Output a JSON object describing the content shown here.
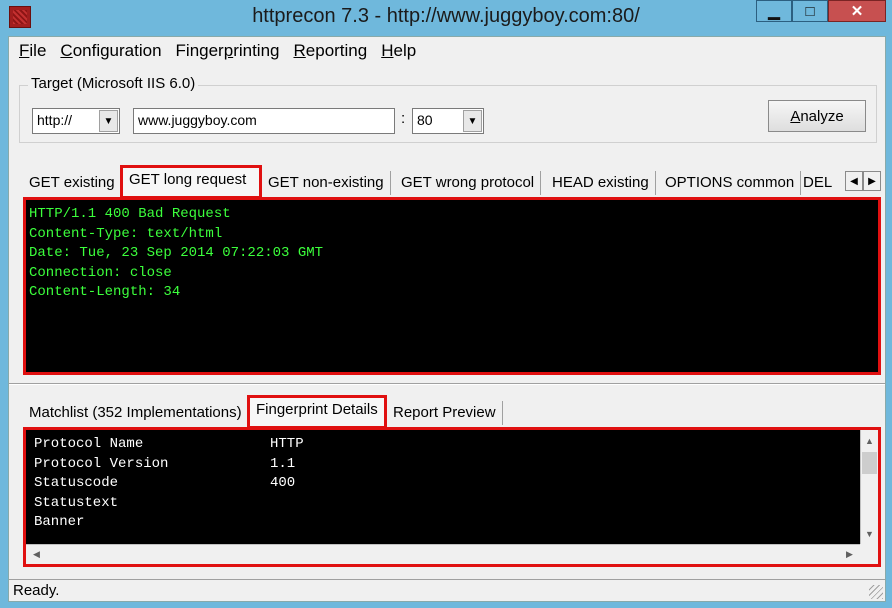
{
  "window": {
    "title": "httprecon 7.3 - http://www.juggyboy.com:80/",
    "controls": {
      "minimize": "▁",
      "maximize": "□",
      "close": "✕"
    }
  },
  "menu": [
    {
      "label": "File",
      "hotkey": "F",
      "rest": "ile"
    },
    {
      "label": "Configuration",
      "hotkey": "C",
      "rest": "onfiguration"
    },
    {
      "label": "Fingerprinting",
      "prefix": "Finger",
      "hotkey": "p",
      "rest": "rinting"
    },
    {
      "label": "Reporting",
      "hotkey": "R",
      "rest": "eporting"
    },
    {
      "label": "Help",
      "hotkey": "H",
      "rest": "elp"
    }
  ],
  "target": {
    "legend": "Target (Microsoft IIS 6.0)",
    "protocol": "http://",
    "host": "www.juggyboy.com",
    "separator": ":",
    "port": "80",
    "analyze_prefix": "",
    "analyze_hotkey": "A",
    "analyze_rest": "nalyze"
  },
  "request_tabs": [
    "GET existing",
    "GET long request",
    "GET non-existing",
    "GET wrong protocol",
    "HEAD existing",
    "OPTIONS common",
    "DEL"
  ],
  "active_request_tab": "GET long request",
  "response_lines": [
    "HTTP/1.1 400 Bad Request",
    "Content-Type: text/html",
    "Date: Tue, 23 Sep 2014 07:22:03 GMT",
    "Connection: close",
    "Content-Length: 34"
  ],
  "result_tabs": [
    "Matchlist (352 Implementations)",
    "Fingerprint Details",
    "Report Preview"
  ],
  "active_result_tab": "Fingerprint Details",
  "fingerprint_details": [
    {
      "key": "Protocol Name",
      "value": "HTTP"
    },
    {
      "key": "Protocol Version",
      "value": "1.1"
    },
    {
      "key": "Statuscode",
      "value": "400"
    },
    {
      "key": "Statustext",
      "value": ""
    },
    {
      "key": "Banner",
      "value": ""
    }
  ],
  "status": "Ready.",
  "icons": {
    "app": "httprecon-icon",
    "dropdown": "chevron-down-icon",
    "tab_left": "arrow-left-icon",
    "tab_right": "arrow-right-icon"
  },
  "colors": {
    "highlight": "#e01010",
    "terminal_bg": "#000000",
    "response_text": "#3cff3c",
    "details_text": "#ffffff",
    "titlebar": "#6fb8dc",
    "close_button": "#c75050"
  }
}
